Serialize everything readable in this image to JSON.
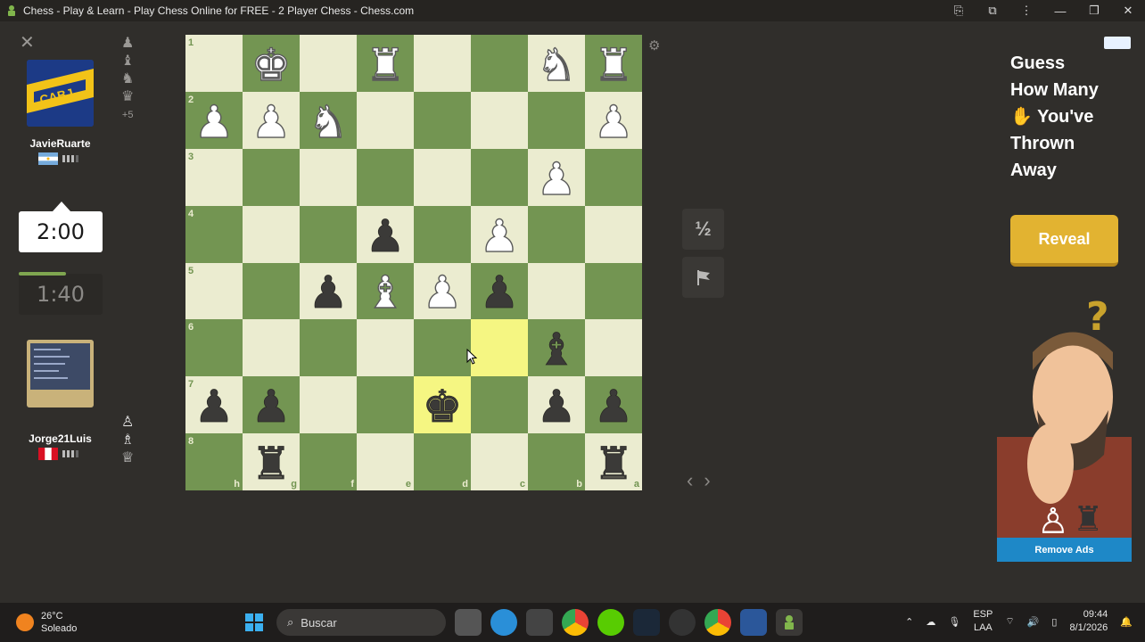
{
  "window": {
    "title": "Chess - Play & Learn - Play Chess Online for FREE - 2 Player Chess - Chess.com"
  },
  "players": {
    "top": {
      "name": "JavieRuarte",
      "clock": "2:00",
      "captured_more": "+5",
      "flag": "argentina"
    },
    "bottom": {
      "name": "Jorge21Luis",
      "clock": "1:40",
      "flag": "peru"
    }
  },
  "board": {
    "orientation": "black",
    "ranks": [
      "1",
      "2",
      "3",
      "4",
      "5",
      "6",
      "7",
      "8"
    ],
    "files": [
      "h",
      "g",
      "f",
      "e",
      "d",
      "c",
      "b",
      "a"
    ],
    "highlight_squares": [
      "c6",
      "d7"
    ],
    "rows": [
      [
        "",
        "wK",
        "",
        "wR",
        "",
        "",
        "wN",
        "wR"
      ],
      [
        "wP",
        "wP",
        "wN",
        "",
        "",
        "",
        "",
        "wP"
      ],
      [
        "",
        "",
        "",
        "",
        "",
        "",
        "wP",
        ""
      ],
      [
        "",
        "",
        "",
        "bP",
        "",
        "wP",
        "",
        ""
      ],
      [
        "",
        "",
        "bP",
        "wB",
        "wP",
        "bP",
        "",
        ""
      ],
      [
        "",
        "",
        "",
        "",
        "",
        "",
        "bB",
        ""
      ],
      [
        "bP",
        "bP",
        "",
        "",
        "bK",
        "",
        "bP",
        "bP"
      ],
      [
        "",
        "bR",
        "",
        "",
        "",
        "",
        "",
        "bR"
      ]
    ]
  },
  "controls": {
    "draw_label": "½",
    "resign_icon": "flag-icon"
  },
  "ad": {
    "headline_1": "Guess",
    "headline_2": "How Many",
    "headline_3": "You've",
    "headline_4": "Thrown",
    "headline_5": "Away",
    "button": "Reveal",
    "remove_ads": "Remove Ads",
    "colors": {
      "button": "#e2b331",
      "remove_bar": "#1e88c7"
    }
  },
  "taskbar": {
    "temperature": "26°C",
    "weather": "Soleado",
    "search_placeholder": "Buscar",
    "lang_1": "ESP",
    "lang_2": "LAA",
    "time": "09:44",
    "date": "8/1/2026"
  },
  "colors": {
    "light_square": "#ebecd0",
    "dark_square": "#739552",
    "highlight": "#f5f682",
    "background": "#302e2b"
  }
}
